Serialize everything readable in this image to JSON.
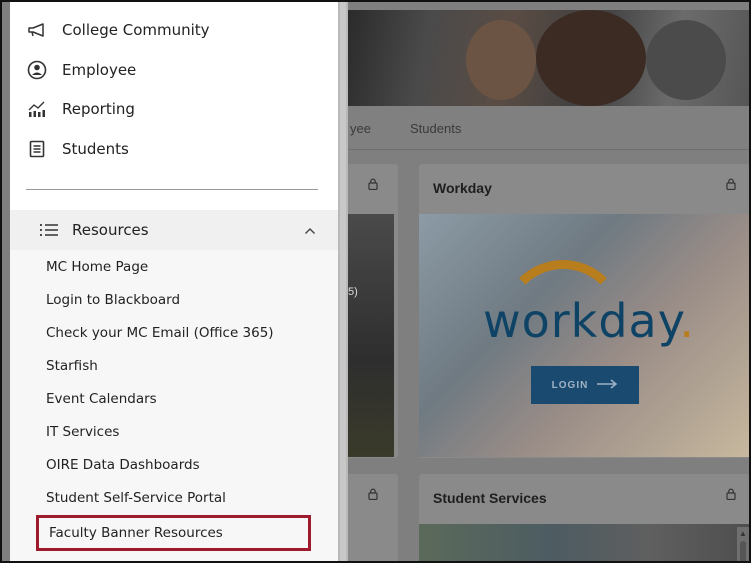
{
  "background_page": {
    "tabs": [
      "yee",
      "Students"
    ],
    "cards": [
      {
        "title": "Workday",
        "login_label": "LOGIN",
        "logo_text": "workday",
        "logo_dot": "."
      },
      {
        "title": "Student Services"
      }
    ],
    "left_card_fragment": "5)"
  },
  "drawer": {
    "nav_items": [
      {
        "label": "College Community",
        "icon": "megaphone-icon"
      },
      {
        "label": "Employee",
        "icon": "person-circle-icon"
      },
      {
        "label": "Reporting",
        "icon": "bar-chart-icon"
      },
      {
        "label": "Students",
        "icon": "document-icon"
      }
    ],
    "resources": {
      "label": "Resources",
      "icon": "list-icon",
      "expanded": true,
      "links": [
        "MC Home Page",
        "Login to Blackboard",
        "Check your MC Email (Office 365)",
        "Starfish",
        "Event Calendars",
        "IT Services",
        "OIRE Data Dashboards",
        "Student Self-Service Portal",
        "Faculty Banner Resources"
      ],
      "highlighted_link": "Faculty Banner Resources"
    }
  },
  "colors": {
    "highlight_border": "#9e1b2e",
    "workday_blue": "#0e4366",
    "workday_arc": "#b87d1d"
  }
}
